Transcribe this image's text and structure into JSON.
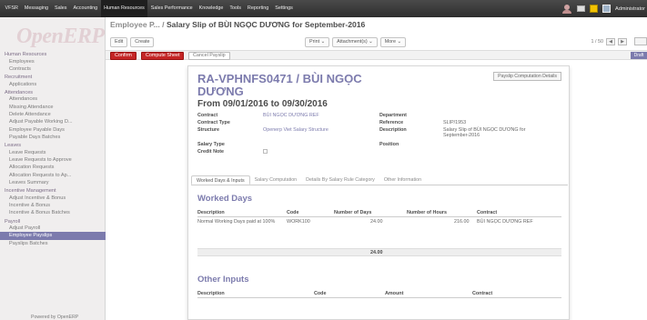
{
  "topbar": {
    "menu": [
      "VFSR",
      "Messaging",
      "Sales",
      "Accounting",
      "Human Resources",
      "Sales Performance",
      "Knowledge",
      "Tools",
      "Reporting",
      "Settings"
    ],
    "active_index": 4,
    "user": "Administrator"
  },
  "sidebar": {
    "logo": "OpenERP",
    "sections": [
      {
        "title": "Human Resources",
        "items": [
          "Employees",
          "Contracts"
        ]
      },
      {
        "title": "Recruitment",
        "items": [
          "Applications"
        ]
      },
      {
        "title": "Attendances",
        "items": [
          "Attendances",
          "Missing Attendance",
          "Delete Attendance",
          "Adjust Payable Working D...",
          "Employee Payable Days",
          "Payable Days Batches"
        ]
      },
      {
        "title": "Leaves",
        "items": [
          "Leave Requests",
          "Leave Requests to Approve",
          "Allocation Requests",
          "Allocation Requests to Ap...",
          "Leaves Summary"
        ]
      },
      {
        "title": "Incentive Management",
        "items": [
          "Adjust Incentive & Bonus",
          "Incentive & Bonus",
          "Incentive & Bonus Batches"
        ]
      },
      {
        "title": "Payroll",
        "items": [
          "Adjust Payroll",
          "Employee Payslips",
          "Payslips Batches"
        ]
      }
    ],
    "selected_item": "Employee Payslips",
    "powered": "Powered by OpenERP"
  },
  "header": {
    "crumb_prefix": "Employee P... /",
    "crumb_title": "Salary Slip of BÙI NGỌC DƯƠNG for September-2016",
    "edit": "Edit",
    "create": "Create",
    "print": "Print ⌄",
    "attachments": "Attachment(s) ⌄",
    "more": "More ⌄",
    "pager": "1 / 50"
  },
  "statusbar": {
    "confirm": "Confirm",
    "compute": "Compute Sheet",
    "cancel": "Cancel Payslip",
    "state": "Draft"
  },
  "sheet": {
    "payslip_btn": "Payslip Computation Details",
    "title": "RA-VPHNFS0471 / BÙI NGỌC DƯƠNG",
    "period": "From 09/01/2016 to 09/30/2016",
    "contract_label": "Contract",
    "contract_value": "BÙI NGỌC DƯƠNG REF",
    "contract_type_label": "Contract Type",
    "structure_label": "Structure",
    "structure_value": "Openerp Viet Salary Structure",
    "department_label": "Department",
    "reference_label": "Reference",
    "reference_value": "SLIP/1953",
    "description_label": "Description",
    "description_value": "Salary Slip of BÙI NGỌC DƯƠNG for September-2016",
    "salary_type_label": "Salary Type",
    "credit_note_label": "Credit Note",
    "position_label": "Position",
    "tabs": [
      "Worked Days & Inputs",
      "Salary Computation",
      "Details By Salary Rule Category",
      "Other Information"
    ],
    "worked_days_title": "Worked Days",
    "wd_headers": [
      "Description",
      "Code",
      "Number of Days",
      "Number of Hours",
      "Contract"
    ],
    "wd_rows": [
      {
        "desc": "Normal Working Days paid at 100%",
        "code": "WORK100",
        "days": "24.00",
        "hours": "216.00",
        "contract": "BÙI NGỌC DƯƠNG REF"
      }
    ],
    "wd_total_days": "24.00",
    "other_inputs_title": "Other Inputs",
    "oi_headers": [
      "Description",
      "Code",
      "Amount",
      "Contract"
    ]
  }
}
